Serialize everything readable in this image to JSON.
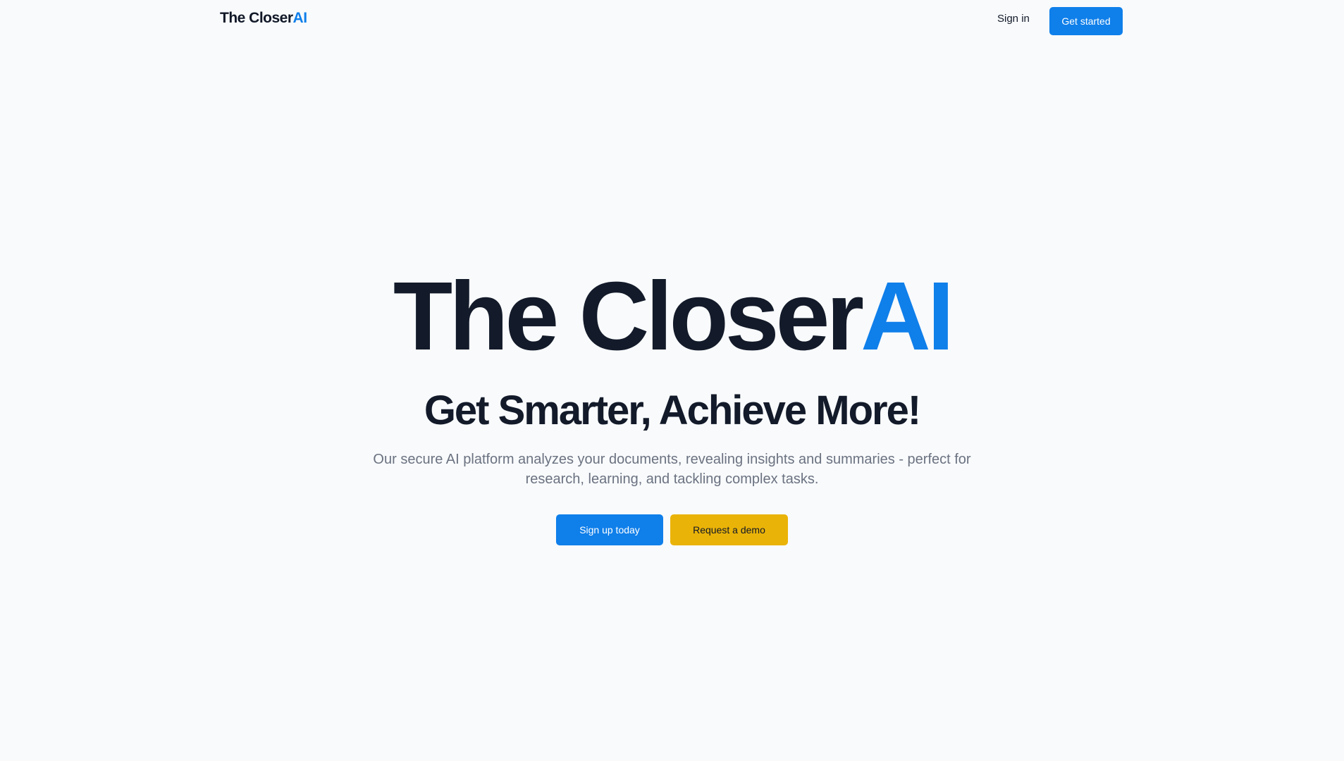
{
  "header": {
    "logo_main": "The Closer",
    "logo_accent": "AI",
    "signin_label": "Sign in",
    "get_started_label": "Get started"
  },
  "hero": {
    "title_main": "The Closer",
    "title_accent": "AI",
    "subtitle": "Get Smarter, Achieve More!",
    "description": "Our secure AI platform analyzes your documents, revealing insights and summaries - perfect for research, learning, and tackling complex tasks.",
    "signup_label": "Sign up today",
    "demo_label": "Request a demo"
  },
  "colors": {
    "accent": "#0f7fea",
    "secondary_button": "#eab308",
    "background": "#f8fafc",
    "heading": "#131a29",
    "muted_text": "#6b7280"
  }
}
